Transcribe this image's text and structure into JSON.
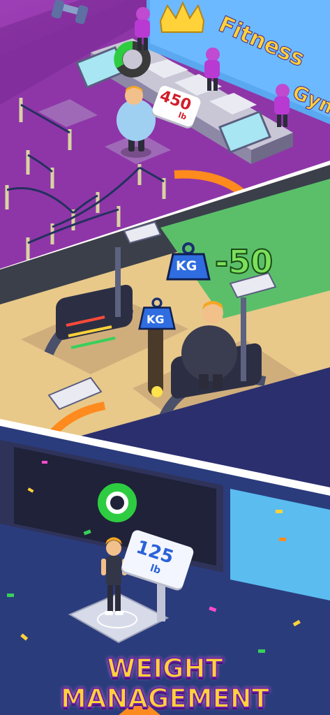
{
  "sign": {
    "line1": "Fitness",
    "line2": "Gym"
  },
  "top_scale": {
    "value": "450",
    "unit": "lb"
  },
  "treadmill_weight_change": {
    "icon": "KG",
    "value": "-50"
  },
  "small_kg_label": "KG",
  "bottom_scale": {
    "value": "125",
    "unit": "lb"
  },
  "title": "WEIGHT MANAGEMENT",
  "colors": {
    "title_fill": "#ffd23a",
    "title_stroke": "#6d1fa8",
    "arrow": "#ff8a1e",
    "progress_ring": "#2ecc40",
    "kg_badge": "#2f6de0"
  }
}
